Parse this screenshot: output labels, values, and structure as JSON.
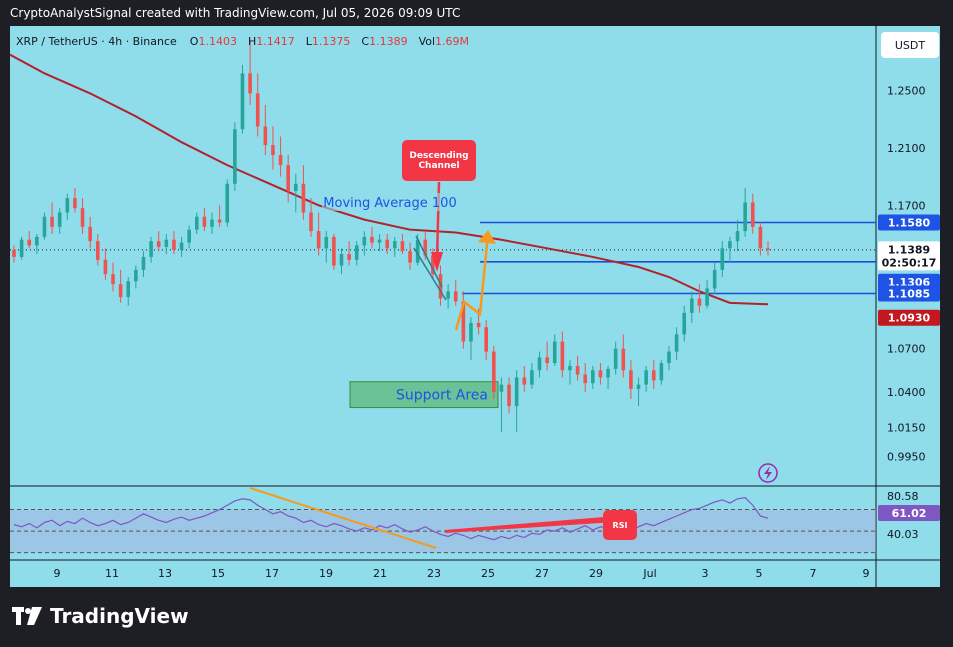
{
  "header": {
    "caption": "CryptoAnalystSignal created with TradingView.com, Jul 05, 2026 09:09 UTC"
  },
  "symbol_bar": {
    "symbol": "XRP / TetherUS · 4h · Binance",
    "o_label": "O",
    "o": "1.1403",
    "h_label": "H",
    "h": "1.1417",
    "l_label": "L",
    "l": "1.1375",
    "c_label": "C",
    "c": "1.1389",
    "vol_label": "Vol",
    "vol": "1.69M"
  },
  "currency_button": "USDT",
  "brand": {
    "name": "TradingView"
  },
  "colors": {
    "background": "#8fdceb",
    "up": "#26a69a",
    "down": "#ef5350",
    "ma": "#b2222b",
    "level_line": "#1f4ed8",
    "arrow": "#f59a1e",
    "channel": "#2e7d8c",
    "callout": "#f23645",
    "rsi": "#7e57c2",
    "label_blue": "#1e53e5",
    "label_red": "#c2181f",
    "label_black": "#131722"
  },
  "chart_data": {
    "type": "candlestick",
    "price_range": [
      0.975,
      1.295
    ],
    "y_ticks": [
      "1.2500",
      "1.2100",
      "1.1700",
      "1.0700",
      "1.0400",
      "1.0150",
      "0.9950"
    ],
    "x_ticks": [
      "9",
      "11",
      "13",
      "15",
      "17",
      "19",
      "21",
      "23",
      "25",
      "27",
      "29",
      "Jul",
      "3",
      "5",
      "7",
      "9"
    ],
    "candles": [
      [
        1.139,
        1.142,
        1.13,
        1.134
      ],
      [
        1.134,
        1.148,
        1.132,
        1.146
      ],
      [
        1.146,
        1.152,
        1.14,
        1.142
      ],
      [
        1.142,
        1.15,
        1.136,
        1.148
      ],
      [
        1.148,
        1.165,
        1.146,
        1.162
      ],
      [
        1.162,
        1.172,
        1.15,
        1.155
      ],
      [
        1.155,
        1.168,
        1.15,
        1.165
      ],
      [
        1.165,
        1.178,
        1.16,
        1.175
      ],
      [
        1.175,
        1.182,
        1.165,
        1.168
      ],
      [
        1.168,
        1.175,
        1.15,
        1.155
      ],
      [
        1.155,
        1.162,
        1.14,
        1.145
      ],
      [
        1.145,
        1.15,
        1.128,
        1.132
      ],
      [
        1.132,
        1.14,
        1.118,
        1.122
      ],
      [
        1.122,
        1.13,
        1.11,
        1.115
      ],
      [
        1.115,
        1.125,
        1.102,
        1.106
      ],
      [
        1.106,
        1.12,
        1.1,
        1.117
      ],
      [
        1.117,
        1.128,
        1.112,
        1.125
      ],
      [
        1.125,
        1.138,
        1.12,
        1.134
      ],
      [
        1.134,
        1.148,
        1.13,
        1.145
      ],
      [
        1.145,
        1.152,
        1.138,
        1.141
      ],
      [
        1.141,
        1.15,
        1.136,
        1.146
      ],
      [
        1.146,
        1.152,
        1.136,
        1.139
      ],
      [
        1.139,
        1.148,
        1.134,
        1.144
      ],
      [
        1.144,
        1.156,
        1.14,
        1.153
      ],
      [
        1.153,
        1.165,
        1.15,
        1.162
      ],
      [
        1.162,
        1.168,
        1.152,
        1.155
      ],
      [
        1.155,
        1.165,
        1.15,
        1.16
      ],
      [
        1.16,
        1.17,
        1.155,
        1.158
      ],
      [
        1.158,
        1.188,
        1.155,
        1.185
      ],
      [
        1.185,
        1.228,
        1.18,
        1.223
      ],
      [
        1.223,
        1.268,
        1.22,
        1.262
      ],
      [
        1.262,
        1.285,
        1.24,
        1.248
      ],
      [
        1.248,
        1.262,
        1.218,
        1.225
      ],
      [
        1.225,
        1.24,
        1.205,
        1.212
      ],
      [
        1.212,
        1.225,
        1.195,
        1.205
      ],
      [
        1.205,
        1.218,
        1.19,
        1.198
      ],
      [
        1.198,
        1.205,
        1.172,
        1.18
      ],
      [
        1.18,
        1.192,
        1.165,
        1.185
      ],
      [
        1.185,
        1.198,
        1.16,
        1.165
      ],
      [
        1.165,
        1.175,
        1.148,
        1.152
      ],
      [
        1.152,
        1.165,
        1.135,
        1.14
      ],
      [
        1.14,
        1.152,
        1.13,
        1.148
      ],
      [
        1.148,
        1.15,
        1.125,
        1.128
      ],
      [
        1.128,
        1.14,
        1.122,
        1.136
      ],
      [
        1.136,
        1.145,
        1.128,
        1.132
      ],
      [
        1.132,
        1.145,
        1.128,
        1.142
      ],
      [
        1.142,
        1.152,
        1.135,
        1.148
      ],
      [
        1.148,
        1.155,
        1.14,
        1.144
      ],
      [
        1.144,
        1.15,
        1.138,
        1.146
      ],
      [
        1.146,
        1.15,
        1.136,
        1.14
      ],
      [
        1.14,
        1.148,
        1.134,
        1.145
      ],
      [
        1.145,
        1.15,
        1.136,
        1.138
      ],
      [
        1.138,
        1.144,
        1.125,
        1.13
      ],
      [
        1.13,
        1.15,
        1.128,
        1.146
      ],
      [
        1.146,
        1.152,
        1.132,
        1.135
      ],
      [
        1.135,
        1.14,
        1.118,
        1.122
      ],
      [
        1.122,
        1.128,
        1.1,
        1.105
      ],
      [
        1.105,
        1.115,
        1.098,
        1.11
      ],
      [
        1.11,
        1.118,
        1.1,
        1.103
      ],
      [
        1.103,
        1.11,
        1.07,
        1.075
      ],
      [
        1.075,
        1.092,
        1.062,
        1.088
      ],
      [
        1.088,
        1.098,
        1.08,
        1.085
      ],
      [
        1.085,
        1.09,
        1.062,
        1.068
      ],
      [
        1.068,
        1.072,
        1.035,
        1.04
      ],
      [
        1.04,
        1.05,
        1.012,
        1.045
      ],
      [
        1.045,
        1.05,
        1.025,
        1.03
      ],
      [
        1.03,
        1.055,
        1.012,
        1.05
      ],
      [
        1.05,
        1.058,
        1.04,
        1.045
      ],
      [
        1.045,
        1.06,
        1.042,
        1.055
      ],
      [
        1.055,
        1.068,
        1.05,
        1.064
      ],
      [
        1.064,
        1.075,
        1.055,
        1.06
      ],
      [
        1.06,
        1.08,
        1.058,
        1.075
      ],
      [
        1.075,
        1.082,
        1.05,
        1.055
      ],
      [
        1.055,
        1.062,
        1.045,
        1.058
      ],
      [
        1.058,
        1.065,
        1.048,
        1.052
      ],
      [
        1.052,
        1.06,
        1.04,
        1.046
      ],
      [
        1.046,
        1.058,
        1.042,
        1.055
      ],
      [
        1.055,
        1.06,
        1.045,
        1.05
      ],
      [
        1.05,
        1.058,
        1.042,
        1.056
      ],
      [
        1.056,
        1.075,
        1.052,
        1.07
      ],
      [
        1.07,
        1.08,
        1.05,
        1.055
      ],
      [
        1.055,
        1.062,
        1.035,
        1.042
      ],
      [
        1.042,
        1.05,
        1.03,
        1.045
      ],
      [
        1.045,
        1.058,
        1.04,
        1.055
      ],
      [
        1.055,
        1.062,
        1.042,
        1.048
      ],
      [
        1.048,
        1.062,
        1.045,
        1.06
      ],
      [
        1.06,
        1.072,
        1.055,
        1.068
      ],
      [
        1.068,
        1.085,
        1.062,
        1.08
      ],
      [
        1.08,
        1.1,
        1.075,
        1.095
      ],
      [
        1.095,
        1.11,
        1.088,
        1.105
      ],
      [
        1.105,
        1.115,
        1.095,
        1.1
      ],
      [
        1.1,
        1.118,
        1.098,
        1.112
      ],
      [
        1.112,
        1.13,
        1.108,
        1.125
      ],
      [
        1.125,
        1.145,
        1.12,
        1.14
      ],
      [
        1.14,
        1.148,
        1.13,
        1.145
      ],
      [
        1.145,
        1.16,
        1.138,
        1.152
      ],
      [
        1.152,
        1.182,
        1.148,
        1.172
      ],
      [
        1.172,
        1.178,
        1.15,
        1.155
      ],
      [
        1.155,
        1.158,
        1.135,
        1.14
      ],
      [
        1.14,
        1.145,
        1.135,
        1.139
      ]
    ],
    "moving_average_100": [
      [
        0,
        1.275
      ],
      [
        4,
        1.262
      ],
      [
        10,
        1.248
      ],
      [
        16,
        1.232
      ],
      [
        22,
        1.214
      ],
      [
        28,
        1.198
      ],
      [
        34,
        1.184
      ],
      [
        40,
        1.17
      ],
      [
        46,
        1.16
      ],
      [
        52,
        1.153
      ],
      [
        58,
        1.151
      ],
      [
        64,
        1.146
      ],
      [
        70,
        1.14
      ],
      [
        76,
        1.134
      ],
      [
        82,
        1.127
      ],
      [
        86,
        1.12
      ],
      [
        90,
        1.11
      ],
      [
        94,
        1.102
      ],
      [
        99,
        1.101
      ]
    ],
    "levels": [
      {
        "price": 1.158,
        "label": "1.1580"
      },
      {
        "price": 1.1306,
        "label": "1.1306"
      },
      {
        "price": 1.1085,
        "label": "1.1085"
      }
    ],
    "last_price": {
      "label": "1.1389",
      "countdown": "02:50:17"
    },
    "ma_label": "1.0930",
    "annotations": {
      "moving_average_text": "Moving Average 100",
      "descending_channel_text": [
        "Descending",
        "Channel"
      ],
      "support_area_text": "Support Area",
      "rsi_text": "RSI"
    },
    "rsi": {
      "ticks": [
        "80.58",
        "61.02",
        "40.03"
      ],
      "current": "61.02",
      "values": [
        56,
        54,
        57,
        53,
        58,
        60,
        55,
        59,
        57,
        62,
        58,
        55,
        57,
        60,
        56,
        58,
        62,
        66,
        63,
        60,
        58,
        61,
        63,
        60,
        62,
        64,
        67,
        70,
        74,
        78,
        80,
        79,
        74,
        70,
        66,
        68,
        64,
        62,
        58,
        60,
        56,
        54,
        57,
        55,
        52,
        50,
        53,
        51,
        55,
        53,
        56,
        52,
        49,
        51,
        54,
        50,
        47,
        45,
        48,
        46,
        43,
        46,
        44,
        42,
        45,
        43,
        46,
        44,
        48,
        47,
        51,
        50,
        53,
        49,
        52,
        55,
        51,
        54,
        53,
        56,
        52,
        50,
        54,
        57,
        55,
        58,
        61,
        64,
        67,
        70,
        71,
        74,
        77,
        79,
        76,
        80,
        81,
        74,
        64,
        62
      ]
    }
  }
}
